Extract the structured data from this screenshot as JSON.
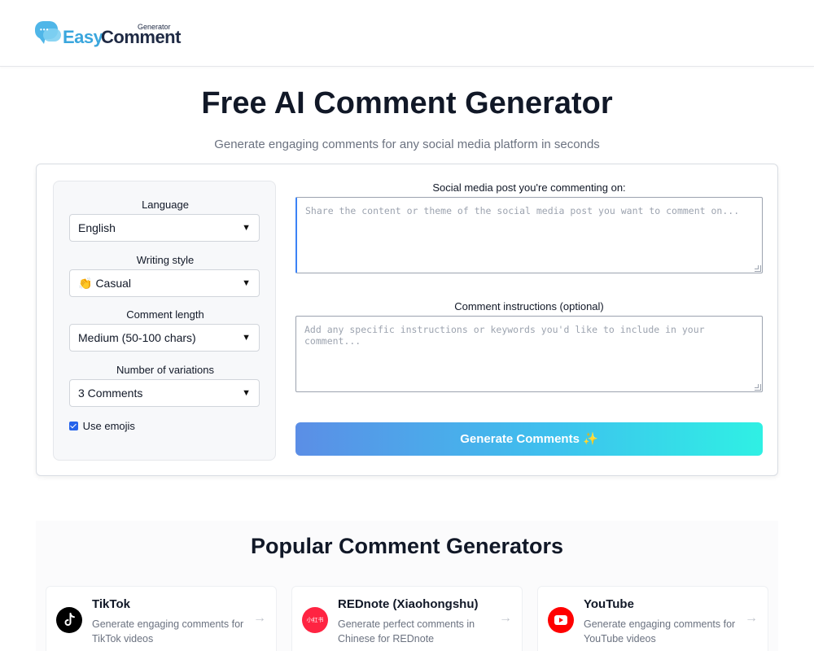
{
  "header": {
    "logo_easy": "Easy",
    "logo_comment": "Comment",
    "logo_generator": "Generator"
  },
  "hero": {
    "title": "Free AI Comment Generator",
    "subtitle": "Generate engaging comments for any social media platform in seconds"
  },
  "settings": {
    "language_label": "Language",
    "language_value": "English",
    "style_label": "Writing style",
    "style_emoji": "👏",
    "style_value": "Casual",
    "length_label": "Comment length",
    "length_value": "Medium (50-100 chars)",
    "variations_label": "Number of variations",
    "variations_value": "3 Comments",
    "emoji_label": "Use emojis",
    "emoji_checked": true,
    "caret": "▼"
  },
  "form": {
    "post_label": "Social media post you're commenting on:",
    "post_placeholder": "Share the content or theme of the social media post you want to comment on...",
    "instructions_label": "Comment instructions (optional)",
    "instructions_placeholder": "Add any specific instructions or keywords you'd like to include in your comment...",
    "generate_label": "Generate Comments ✨"
  },
  "popular": {
    "title": "Popular Comment Generators",
    "arrow": "→",
    "items": [
      {
        "name": "TikTok",
        "desc": "Generate engaging comments for TikTok videos",
        "icon": "tiktok-icon",
        "color": "#000000",
        "glyph": "♪"
      },
      {
        "name": "REDnote (Xiaohongshu)",
        "desc": "Generate perfect comments in Chinese for REDnote",
        "icon": "rednote-icon",
        "color": "#ff2442",
        "glyph": "小红书"
      },
      {
        "name": "YouTube",
        "desc": "Generate engaging comments for YouTube videos",
        "icon": "youtube-icon",
        "color": "#ff0000",
        "glyph": "▶"
      }
    ]
  },
  "colors": {
    "accent": "#3b82f6",
    "button_gradient_start": "#5b8ee6",
    "button_gradient_end": "#2ff0e4",
    "brand_blue": "#3aa6dd",
    "brand_dark": "#1f2a44"
  }
}
